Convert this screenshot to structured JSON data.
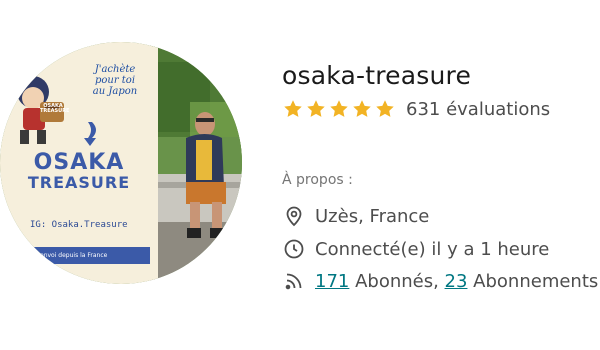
{
  "avatar": {
    "poster_title_line1": "OSAKA",
    "poster_title_line2": "TREASURE",
    "poster_tagline": [
      "J'achète",
      "pour toi",
      "au Japon"
    ],
    "poster_handle": "IG: Osaka.Treasure",
    "poster_footer": "envoi depuis la France",
    "box_label": "OSAKA TREASURE"
  },
  "profile": {
    "username": "osaka-treasure",
    "rating_stars": 5,
    "rating_max": 5,
    "rating_count_label": "631 évaluations"
  },
  "about": {
    "label": "À propos :",
    "location": "Uzès, France",
    "last_seen": "Connecté(e) il y a 1 heure",
    "followers_count": "171",
    "followers_label": " Abonnés, ",
    "following_count": "23",
    "following_label": " Abonnements"
  },
  "colors": {
    "star": "#f2b324",
    "link": "#007782",
    "text": "#4d4d4d",
    "poster_bg": "#f6efdc",
    "poster_blue": "#3b5aa8"
  },
  "icons": [
    "location-pin-icon",
    "clock-icon",
    "rss-feed-icon",
    "star-icon"
  ]
}
